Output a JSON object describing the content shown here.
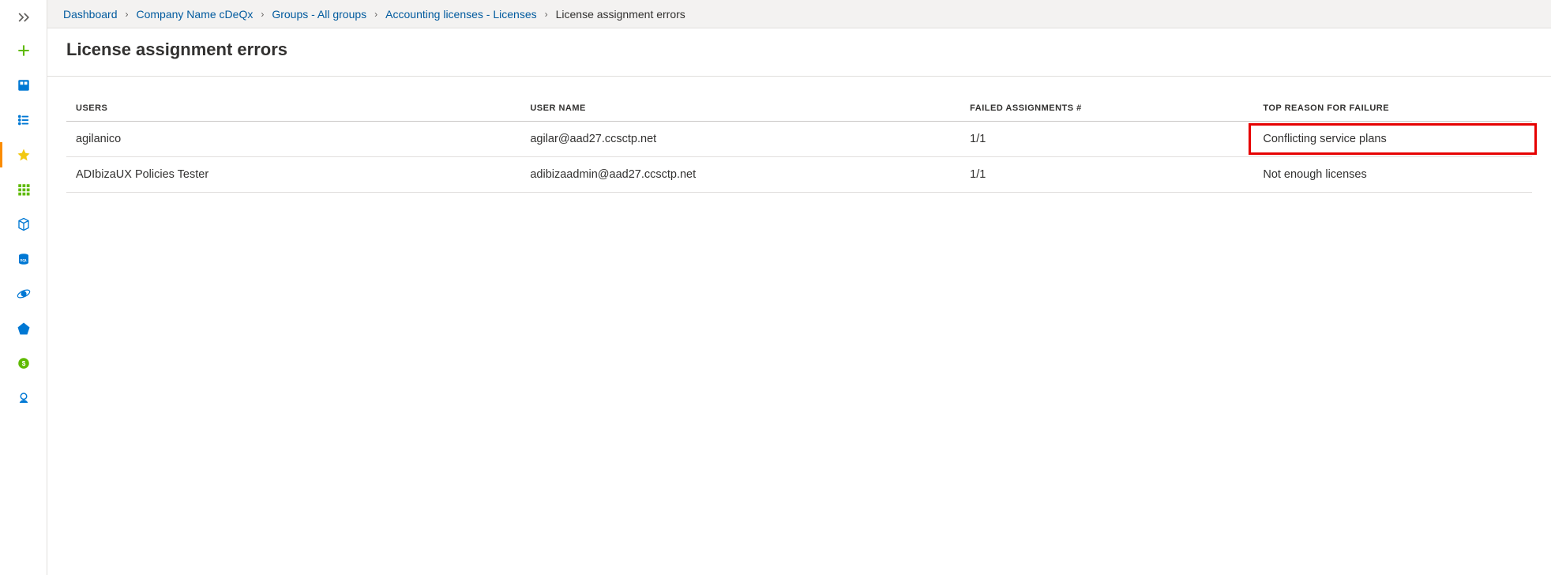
{
  "breadcrumb": {
    "items": [
      {
        "label": "Dashboard"
      },
      {
        "label": "Company Name cDeQx"
      },
      {
        "label": "Groups - All groups"
      },
      {
        "label": "Accounting licenses - Licenses"
      }
    ],
    "current": "License assignment errors"
  },
  "page": {
    "title": "License assignment errors"
  },
  "table": {
    "columns": {
      "users": "USERS",
      "username": "USER NAME",
      "failed": "FAILED ASSIGNMENTS #",
      "reason": "TOP REASON FOR FAILURE"
    },
    "rows": [
      {
        "users": "agilanico",
        "username": "agilar@aad27.ccsctp.net",
        "failed": "1/1",
        "reason": "Conflicting service plans",
        "highlight": true
      },
      {
        "users": "ADIbizaUX Policies Tester",
        "username": "adibizaadmin@aad27.ccsctp.net",
        "failed": "1/1",
        "reason": "Not enough licenses",
        "highlight": false
      }
    ]
  },
  "sidebar_icons": [
    "add-icon",
    "dashboard-icon",
    "list-icon",
    "star-icon",
    "app-grid-icon",
    "cube-icon",
    "sql-icon",
    "cosmos-icon",
    "aad-icon",
    "cost-icon",
    "advisor-icon"
  ],
  "colors": {
    "link": "#005a9e",
    "highlight_border": "#e60000"
  }
}
